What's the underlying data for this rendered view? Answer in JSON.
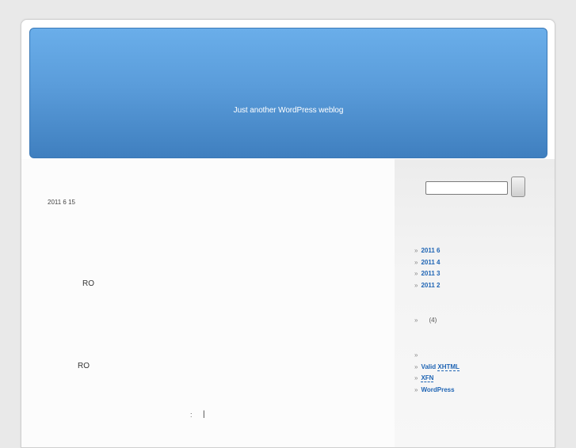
{
  "header": {
    "tagline": "Just another WordPress weblog"
  },
  "post": {
    "date": "2011 6 15",
    "lines": [
      "RO",
      "RO"
    ],
    "footer_colon": ":",
    "footer_separator": "|"
  },
  "sidebar": {
    "search": {
      "button_label": ""
    },
    "archives": [
      {
        "label": "2011 6"
      },
      {
        "label": "2011 4"
      },
      {
        "label": "2011 3"
      },
      {
        "label": "2011 2"
      }
    ],
    "categories": [
      {
        "label": "",
        "count": "(4)"
      }
    ],
    "meta": [
      {
        "prefix": "",
        "label": ""
      },
      {
        "prefix": "Valid ",
        "label": "XHTML"
      },
      {
        "prefix": "",
        "label": "XFN"
      },
      {
        "prefix": "",
        "label": "WordPress"
      }
    ]
  },
  "colors": {
    "header_top": "#6aaeea",
    "header_bottom": "#3f7fbf",
    "link": "#1e64b4",
    "page_bg": "#e9e9e9"
  }
}
